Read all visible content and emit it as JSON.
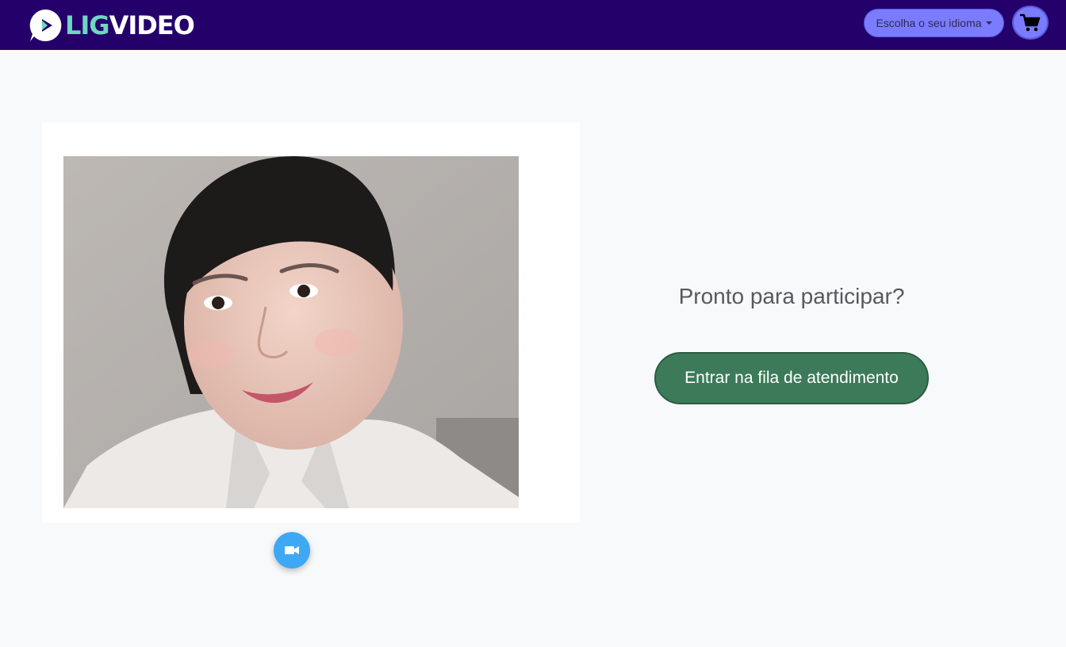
{
  "header": {
    "logo_part1": "LIG",
    "logo_part2": "VIDEO",
    "language_select_label": "Escolha o seu idioma",
    "cart_icon": "cart-icon"
  },
  "main": {
    "camera_toggle_icon": "video-camera-icon",
    "ready_title": "Pronto para participar?",
    "join_button_label": "Entrar na fila de atendimento"
  },
  "colors": {
    "navbar": "#24006b",
    "accent": "#7b7bff",
    "logo_accent": "#6fd6c2",
    "join_button": "#3c7a59",
    "camera_button": "#3ea8f5"
  }
}
